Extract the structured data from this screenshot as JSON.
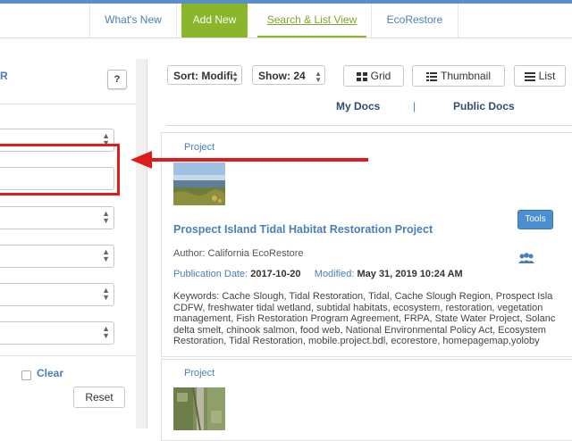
{
  "nav": {
    "whats_new": "What's New",
    "add_new": "Add New",
    "search_list": "Search & List View",
    "ecorestore": "EcoRestore"
  },
  "filter_panel": {
    "title_fragment": "R",
    "help_label": "?",
    "clear_label": "Clear",
    "reset_label": "Reset"
  },
  "toolbar": {
    "sort_label": "Sort: Modifi",
    "show_label": "Show: 24",
    "grid_label": "Grid",
    "thumbnail_label": "Thumbnail",
    "list_label": "List"
  },
  "doc_tabs": {
    "my_docs": "My Docs",
    "separator": "|",
    "public_docs": "Public Docs"
  },
  "results": [
    {
      "type": "Project",
      "title": "Prospect Island Tidal Habitat Restoration Project",
      "tools_label": "Tools",
      "author_label": "Author: ",
      "author": "California EcoRestore",
      "publication_label": "Publication Date: ",
      "publication_date": "2017-10-20",
      "modified_label": "Modified: ",
      "modified": "May 31, 2019 10:24 AM",
      "keywords": [
        "Keywords: Cache Slough, Tidal Restoration, Tidal, Cache Slough Region, Prospect Isla",
        "CDFW, freshwater tidal wetland, subtidal habitats, ecosystem, restoration, vegetation",
        "management, Fish Restoration Program Agreement, FRPA, State Water Project, Solanc",
        "delta smelt, chinook salmon, food web, National Environmental Policy Act, Ecosystem",
        "Restoration, Tidal Restoration, mobile.project.bdl, ecorestore, homepagemap,yoloby"
      ]
    },
    {
      "type": "Project"
    }
  ],
  "colors": {
    "accent_green": "#8bb52a",
    "link_blue": "#4a7fb5",
    "highlight_red": "#e01b1b",
    "tools_blue": "#4a8fd1"
  }
}
